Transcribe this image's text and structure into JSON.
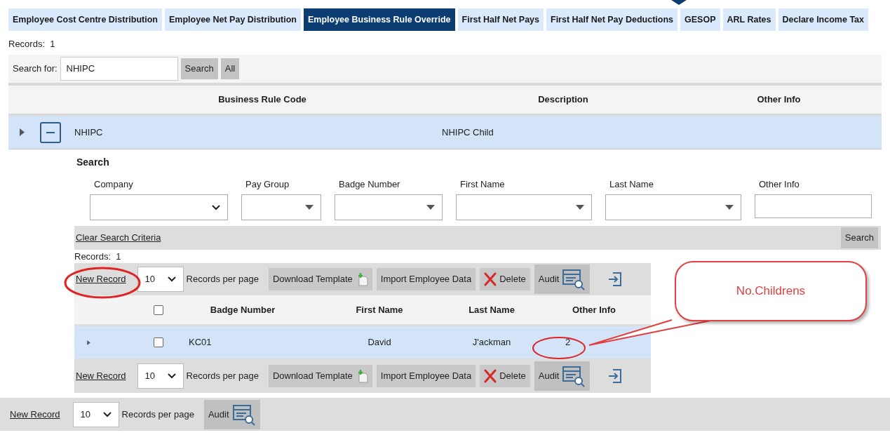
{
  "tabs": [
    {
      "label": "Employee Cost Centre Distribution",
      "selected": false
    },
    {
      "label": "Employee Net Pay Distribution",
      "selected": false
    },
    {
      "label": "Employee Business Rule Override",
      "selected": true
    },
    {
      "label": "First Half Net Pays",
      "selected": false
    },
    {
      "label": "First Half Net Pay Deductions",
      "selected": false
    },
    {
      "label": "GESOP",
      "selected": false
    },
    {
      "label": "ARL Rates",
      "selected": false
    },
    {
      "label": "Declare Income Tax",
      "selected": false
    }
  ],
  "records": "Records:  1",
  "search": {
    "label": "Search for:",
    "value": "NHIPC",
    "buttons": [
      "Search",
      "All"
    ]
  },
  "grid": {
    "columns": [
      "Business Rule Code",
      "Description",
      "Other Info"
    ],
    "rows": [
      {
        "expanded": true,
        "cells": [
          "NHIPC",
          "NHIPC Child"
        ]
      }
    ]
  },
  "child": {
    "search_title": "Search",
    "filters": [
      {
        "label": "Company",
        "kind": "select-chevron"
      },
      {
        "label": "Pay Group",
        "kind": "select"
      },
      {
        "label": "Badge Number",
        "kind": "select"
      },
      {
        "label": "First Name",
        "kind": "select"
      },
      {
        "label": "Last Name",
        "kind": "select"
      },
      {
        "label": "Other Info",
        "kind": "text"
      }
    ],
    "clear_link": "Clear Search Criteria",
    "search_button": "Search",
    "records": "Records:  1",
    "toolbar_top": {
      "new_record": "New Record",
      "page_size": "10",
      "per_page_label": "Records per page",
      "buttons": [
        {
          "kind": "download",
          "label": "Download Template"
        },
        {
          "kind": "import",
          "label": "Import Employee Data"
        },
        {
          "kind": "delete",
          "label": "Delete"
        },
        {
          "kind": "audit",
          "label": "Audit"
        },
        {
          "kind": "export"
        }
      ]
    },
    "header_checked": false,
    "columns": [
      "Badge Number",
      "First Name",
      "Last Name",
      "Other Info"
    ],
    "rows": [
      {
        "expanded": false,
        "checked": false,
        "cells": [
          "KC01",
          "David",
          "J'ackman",
          "2"
        ]
      }
    ],
    "toolbar_bottom": {
      "new_record": "New Record",
      "page_size": "10",
      "per_page_label": "Records per page",
      "buttons": [
        {
          "kind": "download",
          "label": "Download Template"
        },
        {
          "kind": "import",
          "label": "Import Employee Data"
        },
        {
          "kind": "delete",
          "label": "Delete"
        },
        {
          "kind": "audit",
          "label": "Audit"
        },
        {
          "kind": "export"
        }
      ]
    }
  },
  "footer_toolbar": {
    "new_record": "New Record",
    "page_size": "10",
    "per_page_label": "Records per page",
    "buttons": [
      {
        "kind": "audit",
        "label": "Audit"
      }
    ]
  },
  "callout": "No.Childrens"
}
